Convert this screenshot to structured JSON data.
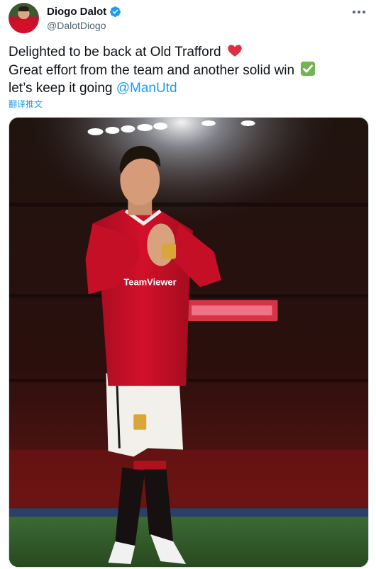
{
  "author": {
    "display_name": "Diogo Dalot",
    "handle": "@DalotDiogo",
    "verified": true
  },
  "tweet": {
    "line1": "Delighted to be back at Old Trafford",
    "line1_emoji": "red-heart",
    "line2": "Great effort from the team and another solid win",
    "line2_emoji": "white-check-mark",
    "line3_text": "let’s keep it going ",
    "line3_mention": "@ManUtd"
  },
  "translate_link": "翻译推文",
  "media": {
    "description_icon": "photo-of-player-applauding",
    "shirt_sponsor": "TeamViewer",
    "colors": {
      "shirt": "#d3102a",
      "shorts": "#f2f0ea",
      "socks": "#1a1a1a",
      "pitch": "#2f5a2a"
    }
  },
  "colors": {
    "accent": "#1d9bf0",
    "text": "#0f1419",
    "secondary": "#536471"
  }
}
